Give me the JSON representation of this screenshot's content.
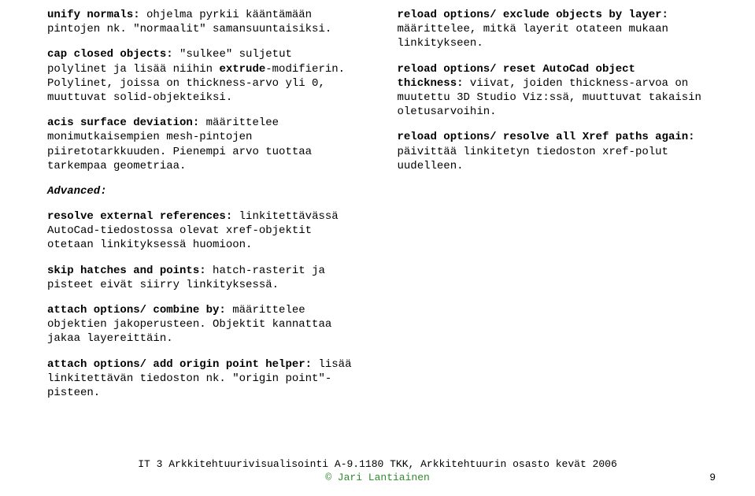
{
  "left": {
    "p1": {
      "bold": "unify normals:",
      "rest": " ohjelma pyrkii kääntämään pintojen nk. \"normaalit\" samansuuntaisiksi."
    },
    "p2": {
      "bold1": "cap closed objects:",
      "mid": " \"sulkee\" suljetut polylinet ja lisää niihin ",
      "bold2": "extrude",
      "rest": "-modifierin. Polylinet, joissa on thickness-arvo yli 0, muuttuvat solid-objekteiksi."
    },
    "p3": {
      "bold": "acis surface deviation:",
      "rest": " määrittelee monimutkaisempien mesh-pintojen piiretotarkkuuden. Pienempi arvo tuottaa tarkempaa geometriaa."
    },
    "advancedLabel": "Advanced:",
    "p4": {
      "bold": "resolve external references:",
      "rest": " linkitettävässä AutoCad-tiedostossa olevat xref-objektit otetaan linkityksessä huomioon."
    },
    "p5": {
      "bold": "skip hatches and points:",
      "rest": " hatch-rasterit ja pisteet eivät siirry linkityksessä."
    },
    "p6": {
      "bold": "attach options/ combine by:",
      "rest": " määrittelee objektien jakoperusteen. Objektit kannattaa jakaa layereittäin."
    },
    "p7": {
      "bold": "attach options/ add origin point helper:",
      "rest": " lisää linkitettävän tiedoston nk. \"origin point\"-pisteen."
    }
  },
  "right": {
    "p1": {
      "bold": "reload options/ exclude objects by layer:",
      "rest": " määrittelee, mitkä layerit otateen mukaan linkitykseen."
    },
    "p2": {
      "bold": "reload options/ reset AutoCad object thickness:",
      "rest": " viivat, joiden thickness-arvoa on muutettu 3D Studio Viz:ssä, muuttuvat takaisin oletusarvoihin."
    },
    "p3": {
      "bold": "reload options/ resolve all Xref paths again:",
      "rest": " päivittää linkitetyn tiedoston xref-polut uudelleen."
    }
  },
  "footer": {
    "line1": "IT 3 Arkkitehtuurivisualisointi A-9.1180 TKK, Arkkitehtuurin osasto kevät 2006",
    "line2": "© Jari Lantiainen",
    "pageNum": "9"
  }
}
